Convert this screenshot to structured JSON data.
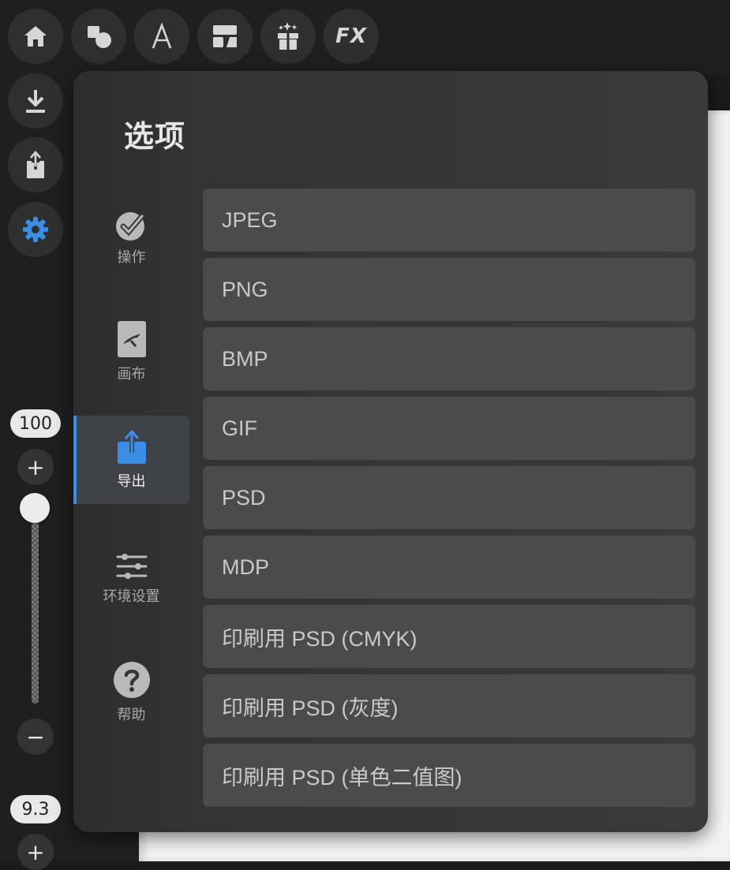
{
  "toolbar": {
    "buttons": [
      {
        "name": "home-button",
        "icon": "home-icon"
      },
      {
        "name": "shapes-button",
        "icon": "shapes-icon"
      },
      {
        "name": "text-button",
        "icon": "text-a-icon"
      },
      {
        "name": "layout-button",
        "icon": "panel-layout-icon"
      },
      {
        "name": "materials-button",
        "icon": "gift-sparkle-icon"
      },
      {
        "name": "fx-button",
        "icon": "fx-icon",
        "label": "FX"
      }
    ]
  },
  "side_tools": {
    "buttons": [
      {
        "name": "import-button",
        "icon": "download-icon"
      },
      {
        "name": "export-button",
        "icon": "share-icon"
      },
      {
        "name": "settings-button",
        "icon": "gear-icon",
        "color": "#3a8ee6"
      }
    ]
  },
  "brush": {
    "size_value": "100",
    "opacity_value": "9.3",
    "slider_level_fraction": 1.0,
    "plus_label": "+",
    "minus_label": "−"
  },
  "dialog": {
    "title": "选项",
    "nav": [
      {
        "label": "操作",
        "icon": "check-badge-icon",
        "active": false
      },
      {
        "label": "画布",
        "icon": "canvas-icon",
        "active": false
      },
      {
        "label": "导出",
        "icon": "export-share-icon",
        "active": true
      },
      {
        "label": "环境设置",
        "icon": "sliders-icon",
        "active": false
      },
      {
        "label": "帮助",
        "icon": "help-icon",
        "active": false
      }
    ],
    "formats": [
      "JPEG",
      "PNG",
      "BMP",
      "GIF",
      "PSD",
      "MDP",
      "印刷用 PSD (CMYK)",
      "印刷用 PSD (灰度)",
      "印刷用 PSD (单色二值图)"
    ]
  },
  "colors": {
    "accent": "#3a8ee6",
    "row_bg": "#4b4b4c",
    "dialog_bg": "#363637"
  }
}
